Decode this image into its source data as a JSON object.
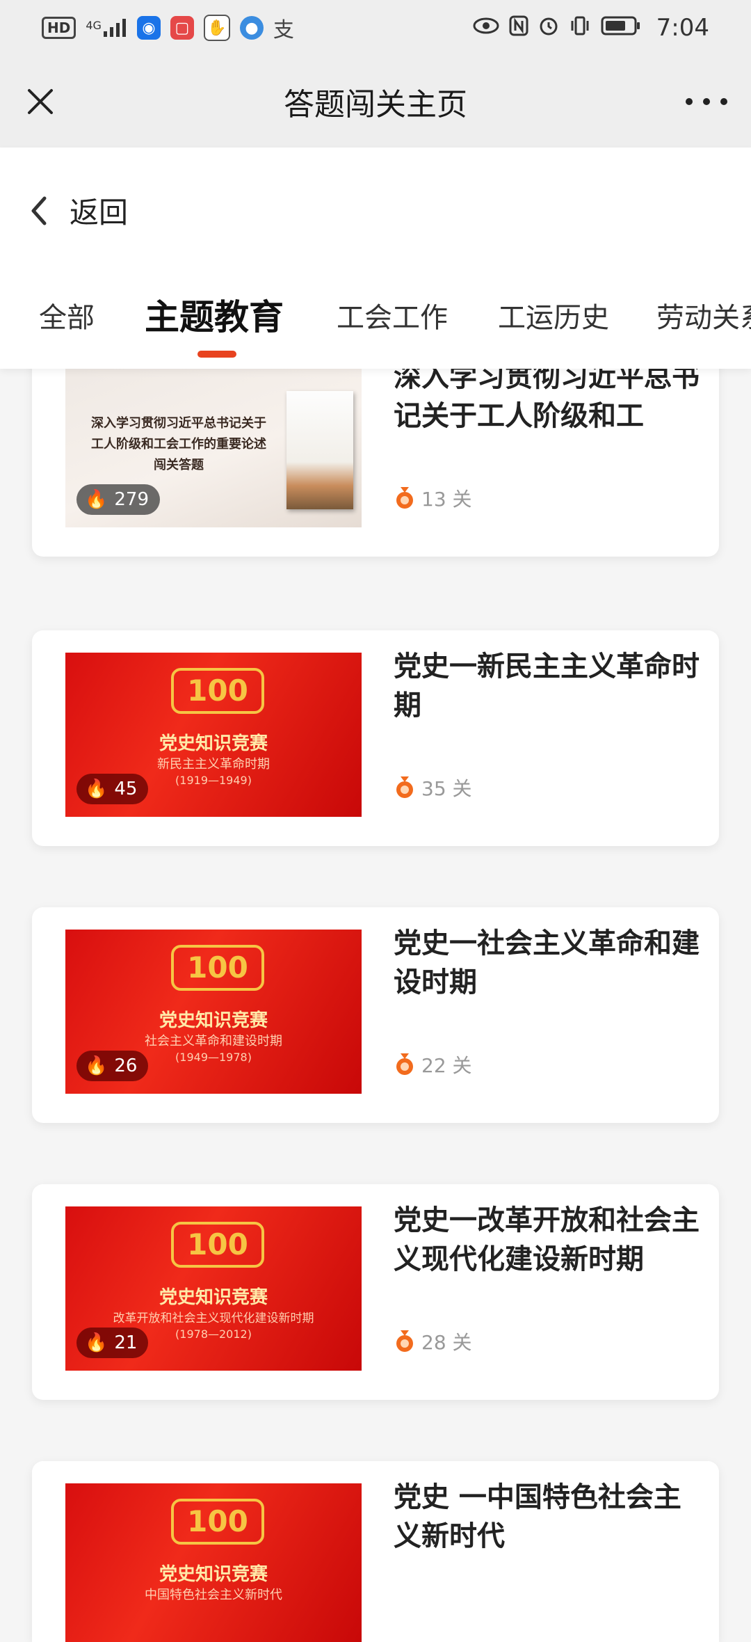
{
  "status_bar": {
    "left_badge": "HD",
    "signal_label": "4G",
    "time": "7:04"
  },
  "titlebar": {
    "title": "答题闯关主页"
  },
  "header": {
    "back_label": "返回",
    "tabs": [
      {
        "label": "全部",
        "active": false
      },
      {
        "label": "主题教育",
        "active": true
      },
      {
        "label": "工会工作",
        "active": false
      },
      {
        "label": "工运历史",
        "active": false
      },
      {
        "label": "劳动关系",
        "active": false
      }
    ]
  },
  "colors": {
    "accent": "#e8431f",
    "red_banner": "#e01a14",
    "medal": "#f26b1d"
  },
  "cards": [
    {
      "title": "深入学习贯彻习近平总书记关于工人阶级和工",
      "heat": "279",
      "levels": "13 关",
      "thumb_style": "pale",
      "thumb_text": [
        "深入学习贯彻习近平总书记关于",
        "工人阶级和工会工作的重要论述",
        "闯关答题"
      ]
    },
    {
      "title": "党史一新民主主义革命时期",
      "heat": "45",
      "levels": "35 关",
      "thumb_style": "red",
      "thumb_text": [
        "党史知识竞赛",
        "新民主主义革命时期",
        "(1919—1949)"
      ]
    },
    {
      "title": "党史一社会主义革命和建设时期",
      "heat": "26",
      "levels": "22 关",
      "thumb_style": "red",
      "thumb_text": [
        "党史知识竞赛",
        "社会主义革命和建设时期",
        "(1949—1978)"
      ]
    },
    {
      "title": "党史一改革开放和社会主义现代化建设新时期",
      "heat": "21",
      "levels": "28 关",
      "thumb_style": "red",
      "thumb_text": [
        "党史知识竞赛",
        "改革开放和社会主义现代化建设新时期",
        "(1978—2012)"
      ]
    },
    {
      "title": "党史 一中国特色社会主义新时代",
      "heat": "",
      "levels": "",
      "thumb_style": "red",
      "thumb_text": [
        "党史知识竞赛",
        "中国特色社会主义新时代",
        ""
      ]
    }
  ]
}
